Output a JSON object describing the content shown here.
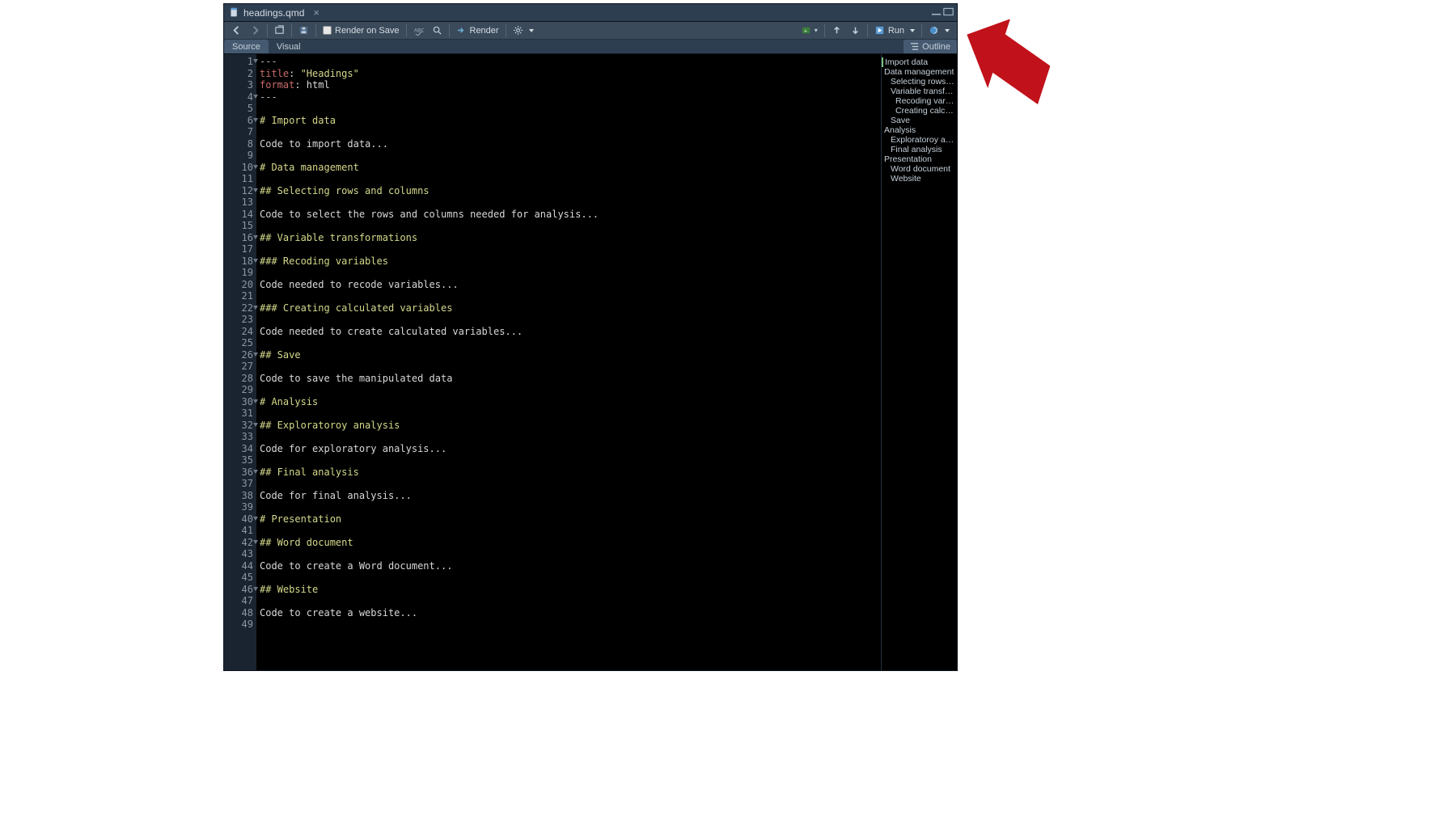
{
  "tab": {
    "filename": "headings.qmd"
  },
  "toolbar": {
    "render_on_save": "Render on Save",
    "render": "Render",
    "run": "Run"
  },
  "subbar": {
    "source": "Source",
    "visual": "Visual",
    "outline": "Outline"
  },
  "code_lines": [
    {
      "n": 1,
      "fold": true,
      "spans": [
        {
          "t": "---",
          "c": "tok-delim"
        }
      ]
    },
    {
      "n": 2,
      "fold": false,
      "spans": [
        {
          "t": "title",
          "c": "tok-key"
        },
        {
          "t": ": ",
          "c": "tok-punct"
        },
        {
          "t": "\"Headings\"",
          "c": "tok-str"
        }
      ]
    },
    {
      "n": 3,
      "fold": false,
      "spans": [
        {
          "t": "format",
          "c": "tok-key"
        },
        {
          "t": ": html",
          "c": "tok-plain"
        }
      ]
    },
    {
      "n": 4,
      "fold": true,
      "spans": [
        {
          "t": "---",
          "c": "tok-delim"
        }
      ]
    },
    {
      "n": 5,
      "fold": false,
      "spans": [
        {
          "t": "",
          "c": "tok-plain"
        }
      ]
    },
    {
      "n": 6,
      "fold": true,
      "spans": [
        {
          "t": "# Import data",
          "c": "tok-str"
        }
      ]
    },
    {
      "n": 7,
      "fold": false,
      "spans": [
        {
          "t": "",
          "c": "tok-plain"
        }
      ]
    },
    {
      "n": 8,
      "fold": false,
      "spans": [
        {
          "t": "Code to import data...",
          "c": "tok-plain"
        }
      ]
    },
    {
      "n": 9,
      "fold": false,
      "spans": [
        {
          "t": "",
          "c": "tok-plain"
        }
      ]
    },
    {
      "n": 10,
      "fold": true,
      "spans": [
        {
          "t": "# Data management",
          "c": "tok-str"
        }
      ]
    },
    {
      "n": 11,
      "fold": false,
      "spans": [
        {
          "t": "",
          "c": "tok-plain"
        }
      ]
    },
    {
      "n": 12,
      "fold": true,
      "spans": [
        {
          "t": "## Selecting rows and columns",
          "c": "tok-str"
        }
      ]
    },
    {
      "n": 13,
      "fold": false,
      "spans": [
        {
          "t": "",
          "c": "tok-plain"
        }
      ]
    },
    {
      "n": 14,
      "fold": false,
      "spans": [
        {
          "t": "Code to select the rows and columns needed for analysis...",
          "c": "tok-plain"
        }
      ]
    },
    {
      "n": 15,
      "fold": false,
      "spans": [
        {
          "t": "",
          "c": "tok-plain"
        }
      ]
    },
    {
      "n": 16,
      "fold": true,
      "spans": [
        {
          "t": "## Variable transformations",
          "c": "tok-str"
        }
      ]
    },
    {
      "n": 17,
      "fold": false,
      "spans": [
        {
          "t": "",
          "c": "tok-plain"
        }
      ]
    },
    {
      "n": 18,
      "fold": true,
      "spans": [
        {
          "t": "### Recoding variables",
          "c": "tok-str"
        }
      ]
    },
    {
      "n": 19,
      "fold": false,
      "spans": [
        {
          "t": "",
          "c": "tok-plain"
        }
      ]
    },
    {
      "n": 20,
      "fold": false,
      "spans": [
        {
          "t": "Code needed to recode variables...",
          "c": "tok-plain"
        }
      ]
    },
    {
      "n": 21,
      "fold": false,
      "spans": [
        {
          "t": "",
          "c": "tok-plain"
        }
      ]
    },
    {
      "n": 22,
      "fold": true,
      "spans": [
        {
          "t": "### Creating calculated variables",
          "c": "tok-str"
        }
      ]
    },
    {
      "n": 23,
      "fold": false,
      "spans": [
        {
          "t": "",
          "c": "tok-plain"
        }
      ]
    },
    {
      "n": 24,
      "fold": false,
      "spans": [
        {
          "t": "Code needed to create calculated variables...",
          "c": "tok-plain"
        }
      ]
    },
    {
      "n": 25,
      "fold": false,
      "spans": [
        {
          "t": "",
          "c": "tok-plain"
        }
      ]
    },
    {
      "n": 26,
      "fold": true,
      "spans": [
        {
          "t": "## Save",
          "c": "tok-str"
        }
      ]
    },
    {
      "n": 27,
      "fold": false,
      "spans": [
        {
          "t": "",
          "c": "tok-plain"
        }
      ]
    },
    {
      "n": 28,
      "fold": false,
      "spans": [
        {
          "t": "Code to save the manipulated data",
          "c": "tok-plain"
        }
      ]
    },
    {
      "n": 29,
      "fold": false,
      "spans": [
        {
          "t": "",
          "c": "tok-plain"
        }
      ]
    },
    {
      "n": 30,
      "fold": true,
      "spans": [
        {
          "t": "# Analysis",
          "c": "tok-str"
        }
      ]
    },
    {
      "n": 31,
      "fold": false,
      "spans": [
        {
          "t": "",
          "c": "tok-plain"
        }
      ]
    },
    {
      "n": 32,
      "fold": true,
      "spans": [
        {
          "t": "## Exploratoroy analysis",
          "c": "tok-str"
        }
      ]
    },
    {
      "n": 33,
      "fold": false,
      "spans": [
        {
          "t": "",
          "c": "tok-plain"
        }
      ]
    },
    {
      "n": 34,
      "fold": false,
      "spans": [
        {
          "t": "Code for exploratory analysis...",
          "c": "tok-plain"
        }
      ]
    },
    {
      "n": 35,
      "fold": false,
      "spans": [
        {
          "t": "",
          "c": "tok-plain"
        }
      ]
    },
    {
      "n": 36,
      "fold": true,
      "spans": [
        {
          "t": "## Final analysis",
          "c": "tok-str"
        }
      ]
    },
    {
      "n": 37,
      "fold": false,
      "spans": [
        {
          "t": "",
          "c": "tok-plain"
        }
      ]
    },
    {
      "n": 38,
      "fold": false,
      "spans": [
        {
          "t": "Code for final analysis...",
          "c": "tok-plain"
        }
      ]
    },
    {
      "n": 39,
      "fold": false,
      "spans": [
        {
          "t": "",
          "c": "tok-plain"
        }
      ]
    },
    {
      "n": 40,
      "fold": true,
      "spans": [
        {
          "t": "# Presentation",
          "c": "tok-str"
        }
      ]
    },
    {
      "n": 41,
      "fold": false,
      "spans": [
        {
          "t": "",
          "c": "tok-plain"
        }
      ]
    },
    {
      "n": 42,
      "fold": true,
      "spans": [
        {
          "t": "## Word document",
          "c": "tok-str"
        }
      ]
    },
    {
      "n": 43,
      "fold": false,
      "spans": [
        {
          "t": "",
          "c": "tok-plain"
        }
      ]
    },
    {
      "n": 44,
      "fold": false,
      "spans": [
        {
          "t": "Code to create a Word document...",
          "c": "tok-plain"
        }
      ]
    },
    {
      "n": 45,
      "fold": false,
      "spans": [
        {
          "t": "",
          "c": "tok-plain"
        }
      ]
    },
    {
      "n": 46,
      "fold": true,
      "spans": [
        {
          "t": "## Website",
          "c": "tok-str"
        }
      ]
    },
    {
      "n": 47,
      "fold": false,
      "spans": [
        {
          "t": "",
          "c": "tok-plain"
        }
      ]
    },
    {
      "n": 48,
      "fold": false,
      "spans": [
        {
          "t": "Code to create a website...",
          "c": "tok-plain"
        }
      ]
    },
    {
      "n": 49,
      "fold": false,
      "spans": [
        {
          "t": "",
          "c": "tok-plain"
        }
      ]
    }
  ],
  "outline": [
    {
      "label": "Import data",
      "level": 1,
      "active": true
    },
    {
      "label": "Data management",
      "level": 1,
      "active": false
    },
    {
      "label": "Selecting rows …",
      "level": 2,
      "active": false
    },
    {
      "label": "Variable transfor…",
      "level": 2,
      "active": false
    },
    {
      "label": "Recoding varia…",
      "level": 3,
      "active": false
    },
    {
      "label": "Creating calcul…",
      "level": 3,
      "active": false
    },
    {
      "label": "Save",
      "level": 2,
      "active": false
    },
    {
      "label": "Analysis",
      "level": 1,
      "active": false
    },
    {
      "label": "Exploratoroy an…",
      "level": 2,
      "active": false
    },
    {
      "label": "Final analysis",
      "level": 2,
      "active": false
    },
    {
      "label": "Presentation",
      "level": 1,
      "active": false
    },
    {
      "label": "Word document",
      "level": 2,
      "active": false
    },
    {
      "label": "Website",
      "level": 2,
      "active": false
    }
  ]
}
